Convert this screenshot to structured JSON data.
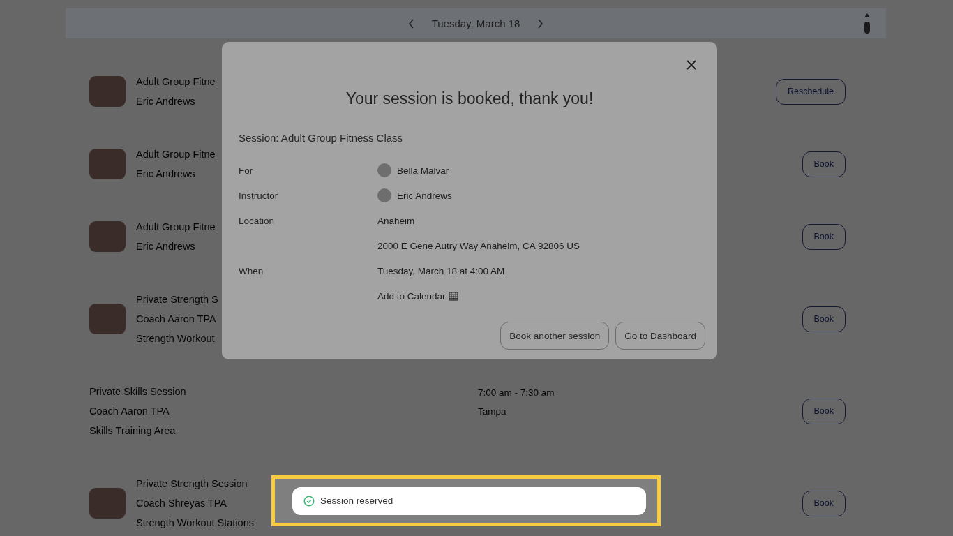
{
  "date_nav": {
    "date": "Tuesday, March 18"
  },
  "sessions": [
    {
      "photo": true,
      "lines": [
        "Adult Group Fitne",
        "Eric Andrews"
      ],
      "button": "Reschedule"
    },
    {
      "photo": true,
      "lines": [
        "Adult Group Fitne",
        "Eric Andrews"
      ],
      "button": "Book"
    },
    {
      "photo": true,
      "lines": [
        "Adult Group Fitne",
        "Eric Andrews"
      ],
      "button": "Book"
    },
    {
      "photo": true,
      "lines": [
        "Private Strength S",
        "Coach Aaron TPA",
        "Strength Workout"
      ],
      "button": "Book"
    },
    {
      "photo": false,
      "lines": [
        "Private Skills Session",
        "Coach Aaron TPA",
        "Skills Training Area"
      ],
      "time": "7:00 am - 7:30 am",
      "location": "Tampa",
      "button": "Book"
    },
    {
      "photo": true,
      "lines": [
        "Private Strength Session",
        "Coach Shreyas TPA",
        "Strength Workout Stations"
      ],
      "button": "Book"
    }
  ],
  "modal": {
    "title": "Your session is booked, thank you!",
    "session": "Session: Adult Group Fitness Class",
    "details": [
      {
        "kind": "person",
        "label": "For",
        "value": "Bella Malvar"
      },
      {
        "kind": "person",
        "label": "Instructor",
        "value": "Eric Andrews"
      },
      {
        "kind": "text",
        "label": "Location",
        "value": "Anaheim"
      },
      {
        "kind": "text",
        "value": "2000 E Gene Autry Way Anaheim, CA 92806 US"
      },
      {
        "kind": "text",
        "label": "When",
        "value": "Tuesday, March 18 at 4:00 AM"
      },
      {
        "kind": "link",
        "value": "Add to Calendar"
      }
    ],
    "buttons": [
      "Book another session",
      "Go to Dashboard"
    ]
  },
  "toast": {
    "message": "Session reserved",
    "highlighted": true
  }
}
